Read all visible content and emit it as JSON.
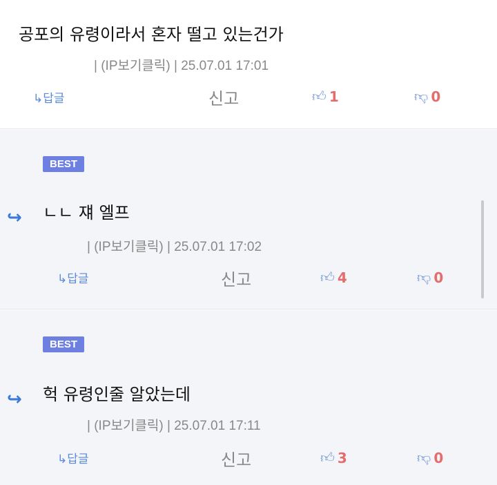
{
  "comments": [
    {
      "text": "공포의 유령이라서 혼자 떨고 있는건가",
      "meta": "| (IP보기클릭) | 25.07.01 17:01",
      "reply_label": "↳답글",
      "report_label": "신고",
      "likes": "1",
      "dislikes": "0"
    },
    {
      "badge": "BEST",
      "text": "ㄴㄴ 쟤 엘프",
      "meta": "| (IP보기클릭) | 25.07.01 17:02",
      "reply_label": "↳답글",
      "report_label": "신고",
      "likes": "4",
      "dislikes": "0"
    },
    {
      "badge": "BEST",
      "text": "헉 유령인줄 알았는데",
      "meta": "| (IP보기클릭) | 25.07.01 17:11",
      "reply_label": "↳답글",
      "report_label": "신고",
      "likes": "3",
      "dislikes": "0"
    }
  ],
  "icons": {
    "thumbs_up": "thumbs-up-icon",
    "thumbs_down": "thumbs-down-icon",
    "reply_arrow": "reply-arrow-icon"
  },
  "colors": {
    "best_badge": "#6d7fe0",
    "vote_count": "#e36c6c",
    "link_blue": "#5b8ad8"
  }
}
